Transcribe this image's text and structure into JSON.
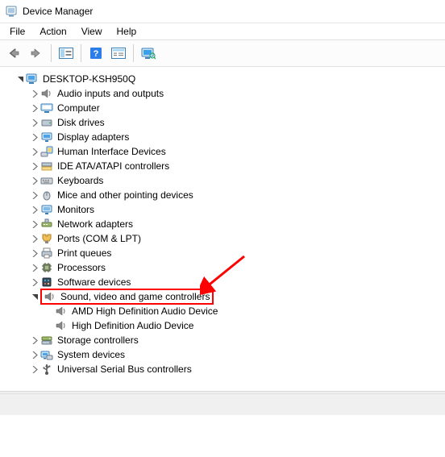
{
  "window": {
    "title": "Device Manager"
  },
  "menubar": {
    "items": [
      "File",
      "Action",
      "View",
      "Help"
    ]
  },
  "toolbar": {
    "buttons": [
      "back",
      "forward",
      "show-hide-tree",
      "help",
      "properties",
      "scan-hardware"
    ]
  },
  "tree": {
    "root": {
      "label": "DESKTOP-KSH950Q",
      "expanded": true
    },
    "categories": [
      {
        "icon": "speaker",
        "label": "Audio inputs and outputs",
        "indent": 1,
        "expandable": true
      },
      {
        "icon": "computer",
        "label": "Computer",
        "indent": 1,
        "expandable": true
      },
      {
        "icon": "disk",
        "label": "Disk drives",
        "indent": 1,
        "expandable": true
      },
      {
        "icon": "display",
        "label": "Display adapters",
        "indent": 1,
        "expandable": true
      },
      {
        "icon": "hid",
        "label": "Human Interface Devices",
        "indent": 1,
        "expandable": true
      },
      {
        "icon": "ide",
        "label": "IDE ATA/ATAPI controllers",
        "indent": 1,
        "expandable": true
      },
      {
        "icon": "keyboard",
        "label": "Keyboards",
        "indent": 1,
        "expandable": true
      },
      {
        "icon": "mouse",
        "label": "Mice and other pointing devices",
        "indent": 1,
        "expandable": true
      },
      {
        "icon": "monitor",
        "label": "Monitors",
        "indent": 1,
        "expandable": true
      },
      {
        "icon": "network",
        "label": "Network adapters",
        "indent": 1,
        "expandable": true
      },
      {
        "icon": "ports",
        "label": "Ports (COM & LPT)",
        "indent": 1,
        "expandable": true
      },
      {
        "icon": "printer",
        "label": "Print queues",
        "indent": 1,
        "expandable": true
      },
      {
        "icon": "processor",
        "label": "Processors",
        "indent": 1,
        "expandable": true
      },
      {
        "icon": "software",
        "label": "Software devices",
        "indent": 1,
        "expandable": true
      },
      {
        "icon": "speaker",
        "label": "Sound, video and game controllers",
        "indent": 1,
        "expandable": true,
        "expanded": true,
        "highlighted": true
      },
      {
        "icon": "speaker",
        "label": "AMD High Definition Audio Device",
        "indent": 2,
        "expandable": false
      },
      {
        "icon": "speaker",
        "label": "High Definition Audio Device",
        "indent": 2,
        "expandable": false
      },
      {
        "icon": "storage",
        "label": "Storage controllers",
        "indent": 1,
        "expandable": true
      },
      {
        "icon": "system",
        "label": "System devices",
        "indent": 1,
        "expandable": true
      },
      {
        "icon": "usb",
        "label": "Universal Serial Bus controllers",
        "indent": 1,
        "expandable": true
      }
    ]
  },
  "annotation": {
    "arrow_color": "#ff0000",
    "highlight_color": "#ff0000"
  }
}
